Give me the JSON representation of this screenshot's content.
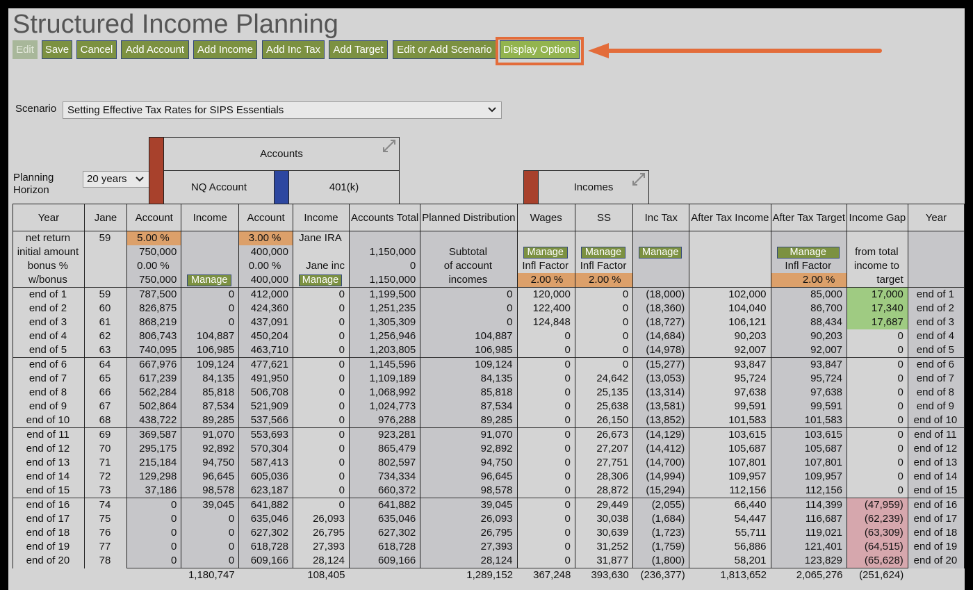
{
  "title": "Structured Income Planning",
  "toolbar": {
    "edit": "Edit",
    "save": "Save",
    "cancel": "Cancel",
    "add_account": "Add Account",
    "add_income": "Add Income",
    "add_inc_tax": "Add Inc Tax",
    "add_target": "Add Target",
    "edit_scenario": "Edit or Add Scenario",
    "display_options": "Display Options"
  },
  "scenario": {
    "label": "Scenario",
    "value": "Setting Effective Tax Rates for SIPS Essentials"
  },
  "planning_horizon": {
    "label_line1": "Planning",
    "label_line2": "Horizon",
    "value": "20 years"
  },
  "groups": {
    "accounts": "Accounts",
    "nq_account": "NQ Account",
    "k401": "401(k)",
    "incomes": "Incomes"
  },
  "colors": {
    "nq": "#a8412c",
    "k401": "#2d47a0",
    "incomes": "#a8412c",
    "highlight": "#e36c3a"
  },
  "headers": [
    "Year",
    "Jane",
    "Account",
    "Income",
    "Account",
    "Income",
    "Accounts Total",
    "Planned Distribution",
    "Wages",
    "SS",
    "Inc Tax",
    "After Tax Income",
    "After Tax Target",
    "Income Gap",
    "Year"
  ],
  "manage_label": "Manage",
  "setup": {
    "net_return_label": "net return",
    "net_return_age": "59",
    "nq_return": "5.00",
    "k401_return": "3.00",
    "pct": "%",
    "jane_ira": "Jane IRA",
    "initial_label": "initial amount",
    "nq_initial": "750,000",
    "k401_initial": "400,000",
    "total_initial": "1,150,000",
    "subtotal": "Subtotal",
    "from_total": "from total",
    "bonus_label": "bonus %",
    "nq_bonus": "0.00",
    "k401_bonus": "0.00",
    "jane_inc": "Jane inc",
    "total_bonus": "0",
    "of_account": "of account",
    "infl_factor": "Infl Factor",
    "income_to": "income to",
    "wbonus_label": "w/bonus",
    "nq_wbonus": "750,000",
    "k401_wbonus": "400,000",
    "total_wbonus": "1,150,000",
    "incomes_word": "incomes",
    "wages_infl": "2.00",
    "ss_infl": "2.00",
    "target_infl": "2.00",
    "target_word": "target"
  },
  "rows": [
    [
      "end of 1",
      "59",
      "787,500",
      "0",
      "412,000",
      "0",
      "1,199,500",
      "0",
      "120,000",
      "0",
      "(18,000)",
      "102,000",
      "85,000",
      "17,000",
      "end of 1"
    ],
    [
      "end of 2",
      "60",
      "826,875",
      "0",
      "424,360",
      "0",
      "1,251,235",
      "0",
      "122,400",
      "0",
      "(18,360)",
      "104,040",
      "86,700",
      "17,340",
      "end of 2"
    ],
    [
      "end of 3",
      "61",
      "868,219",
      "0",
      "437,091",
      "0",
      "1,305,309",
      "0",
      "124,848",
      "0",
      "(18,727)",
      "106,121",
      "88,434",
      "17,687",
      "end of 3"
    ],
    [
      "end of 4",
      "62",
      "806,743",
      "104,887",
      "450,204",
      "0",
      "1,256,946",
      "104,887",
      "0",
      "0",
      "(14,684)",
      "90,203",
      "90,203",
      "0",
      "end of 4"
    ],
    [
      "end of 5",
      "63",
      "740,095",
      "106,985",
      "463,710",
      "0",
      "1,203,805",
      "106,985",
      "0",
      "0",
      "(14,978)",
      "92,007",
      "92,007",
      "0",
      "end of 5"
    ],
    [
      "end of 6",
      "64",
      "667,976",
      "109,124",
      "477,621",
      "0",
      "1,145,596",
      "109,124",
      "0",
      "0",
      "(15,277)",
      "93,847",
      "93,847",
      "0",
      "end of 6"
    ],
    [
      "end of 7",
      "65",
      "617,239",
      "84,135",
      "491,950",
      "0",
      "1,109,189",
      "84,135",
      "0",
      "24,642",
      "(13,053)",
      "95,724",
      "95,724",
      "0",
      "end of 7"
    ],
    [
      "end of 8",
      "66",
      "562,284",
      "85,818",
      "506,708",
      "0",
      "1,068,992",
      "85,818",
      "0",
      "25,135",
      "(13,314)",
      "97,638",
      "97,638",
      "0",
      "end of 8"
    ],
    [
      "end of 9",
      "67",
      "502,864",
      "87,534",
      "521,909",
      "0",
      "1,024,773",
      "87,534",
      "0",
      "25,638",
      "(13,581)",
      "99,591",
      "99,591",
      "0",
      "end of 9"
    ],
    [
      "end of 10",
      "68",
      "438,722",
      "89,285",
      "537,566",
      "0",
      "976,288",
      "89,285",
      "0",
      "26,150",
      "(13,852)",
      "101,583",
      "101,583",
      "0",
      "end of 10"
    ],
    [
      "end of 11",
      "69",
      "369,587",
      "91,070",
      "553,693",
      "0",
      "923,281",
      "91,070",
      "0",
      "26,673",
      "(14,129)",
      "103,615",
      "103,615",
      "0",
      "end of 11"
    ],
    [
      "end of 12",
      "70",
      "295,175",
      "92,892",
      "570,304",
      "0",
      "865,479",
      "92,892",
      "0",
      "27,207",
      "(14,412)",
      "105,687",
      "105,687",
      "0",
      "end of 12"
    ],
    [
      "end of 13",
      "71",
      "215,184",
      "94,750",
      "587,413",
      "0",
      "802,597",
      "94,750",
      "0",
      "27,751",
      "(14,700)",
      "107,801",
      "107,801",
      "0",
      "end of 13"
    ],
    [
      "end of 14",
      "72",
      "129,298",
      "96,645",
      "605,036",
      "0",
      "734,334",
      "96,645",
      "0",
      "28,306",
      "(14,994)",
      "109,957",
      "109,957",
      "0",
      "end of 14"
    ],
    [
      "end of 15",
      "73",
      "37,186",
      "98,578",
      "623,187",
      "0",
      "660,372",
      "98,578",
      "0",
      "28,872",
      "(15,294)",
      "112,156",
      "112,156",
      "0",
      "end of 15"
    ],
    [
      "end of 16",
      "74",
      "0",
      "39,045",
      "641,882",
      "0",
      "641,882",
      "39,045",
      "0",
      "29,449",
      "(2,055)",
      "66,440",
      "114,399",
      "(47,959)",
      "end of 16"
    ],
    [
      "end of 17",
      "75",
      "0",
      "0",
      "635,046",
      "26,093",
      "635,046",
      "26,093",
      "0",
      "30,038",
      "(1,684)",
      "54,447",
      "116,687",
      "(62,239)",
      "end of 17"
    ],
    [
      "end of 18",
      "76",
      "0",
      "0",
      "627,302",
      "26,795",
      "627,302",
      "26,795",
      "0",
      "30,639",
      "(1,723)",
      "55,711",
      "119,021",
      "(63,309)",
      "end of 18"
    ],
    [
      "end of 19",
      "77",
      "0",
      "0",
      "618,728",
      "27,393",
      "618,728",
      "27,393",
      "0",
      "31,252",
      "(1,759)",
      "56,886",
      "121,401",
      "(64,515)",
      "end of 19"
    ],
    [
      "end of 20",
      "78",
      "0",
      "0",
      "609,166",
      "28,124",
      "609,166",
      "28,124",
      "0",
      "31,877",
      "(1,800)",
      "58,201",
      "123,829",
      "(65,628)",
      "end of 20"
    ]
  ],
  "totals": [
    "",
    "",
    "",
    "1,180,747",
    "",
    "108,405",
    "",
    "1,289,152",
    "367,248",
    "393,630",
    "(236,377)",
    "1,813,652",
    "2,065,276",
    "(251,624)",
    ""
  ]
}
